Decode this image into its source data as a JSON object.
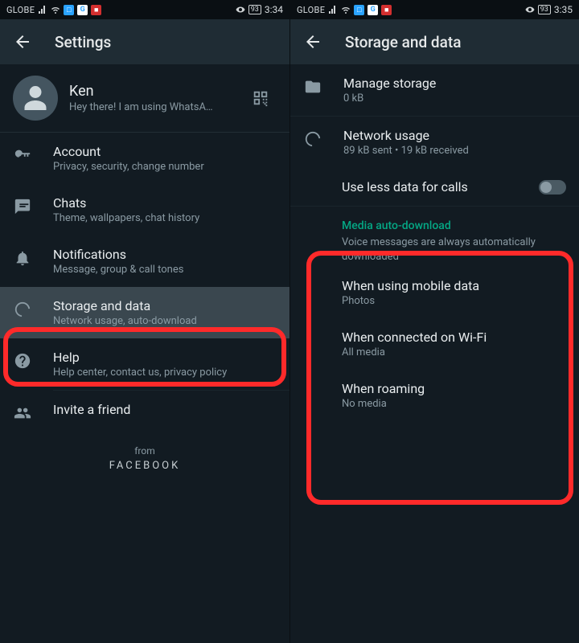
{
  "left": {
    "statusbar": {
      "carrier": "GLOBE",
      "battery": "93",
      "time": "3:34"
    },
    "appbar": {
      "title": "Settings"
    },
    "profile": {
      "name": "Ken",
      "status": "Hey there! I am using WhatsA…"
    },
    "items": [
      {
        "title": "Account",
        "sub": "Privacy, security, change number"
      },
      {
        "title": "Chats",
        "sub": "Theme, wallpapers, chat history"
      },
      {
        "title": "Notifications",
        "sub": "Message, group & call tones"
      },
      {
        "title": "Storage and data",
        "sub": "Network usage, auto-download"
      },
      {
        "title": "Help",
        "sub": "Help center, contact us, privacy policy"
      },
      {
        "title": "Invite a friend"
      }
    ],
    "footer": {
      "from": "from",
      "brand": "FACEBOOK"
    }
  },
  "right": {
    "statusbar": {
      "carrier": "GLOBE",
      "battery": "93",
      "time": "3:35"
    },
    "appbar": {
      "title": "Storage and data"
    },
    "items": {
      "manage_storage": {
        "title": "Manage storage",
        "sub": "0 kB"
      },
      "network_usage": {
        "title": "Network usage",
        "sub": "89 kB sent • 19 kB received"
      },
      "use_less_data": {
        "title": "Use less data for calls"
      }
    },
    "media_section": {
      "header": "Media auto-download",
      "sub": "Voice messages are always automatically downloaded",
      "mobile": {
        "title": "When using mobile data",
        "sub": "Photos"
      },
      "wifi": {
        "title": "When connected on Wi-Fi",
        "sub": "All media"
      },
      "roaming": {
        "title": "When roaming",
        "sub": "No media"
      }
    }
  }
}
